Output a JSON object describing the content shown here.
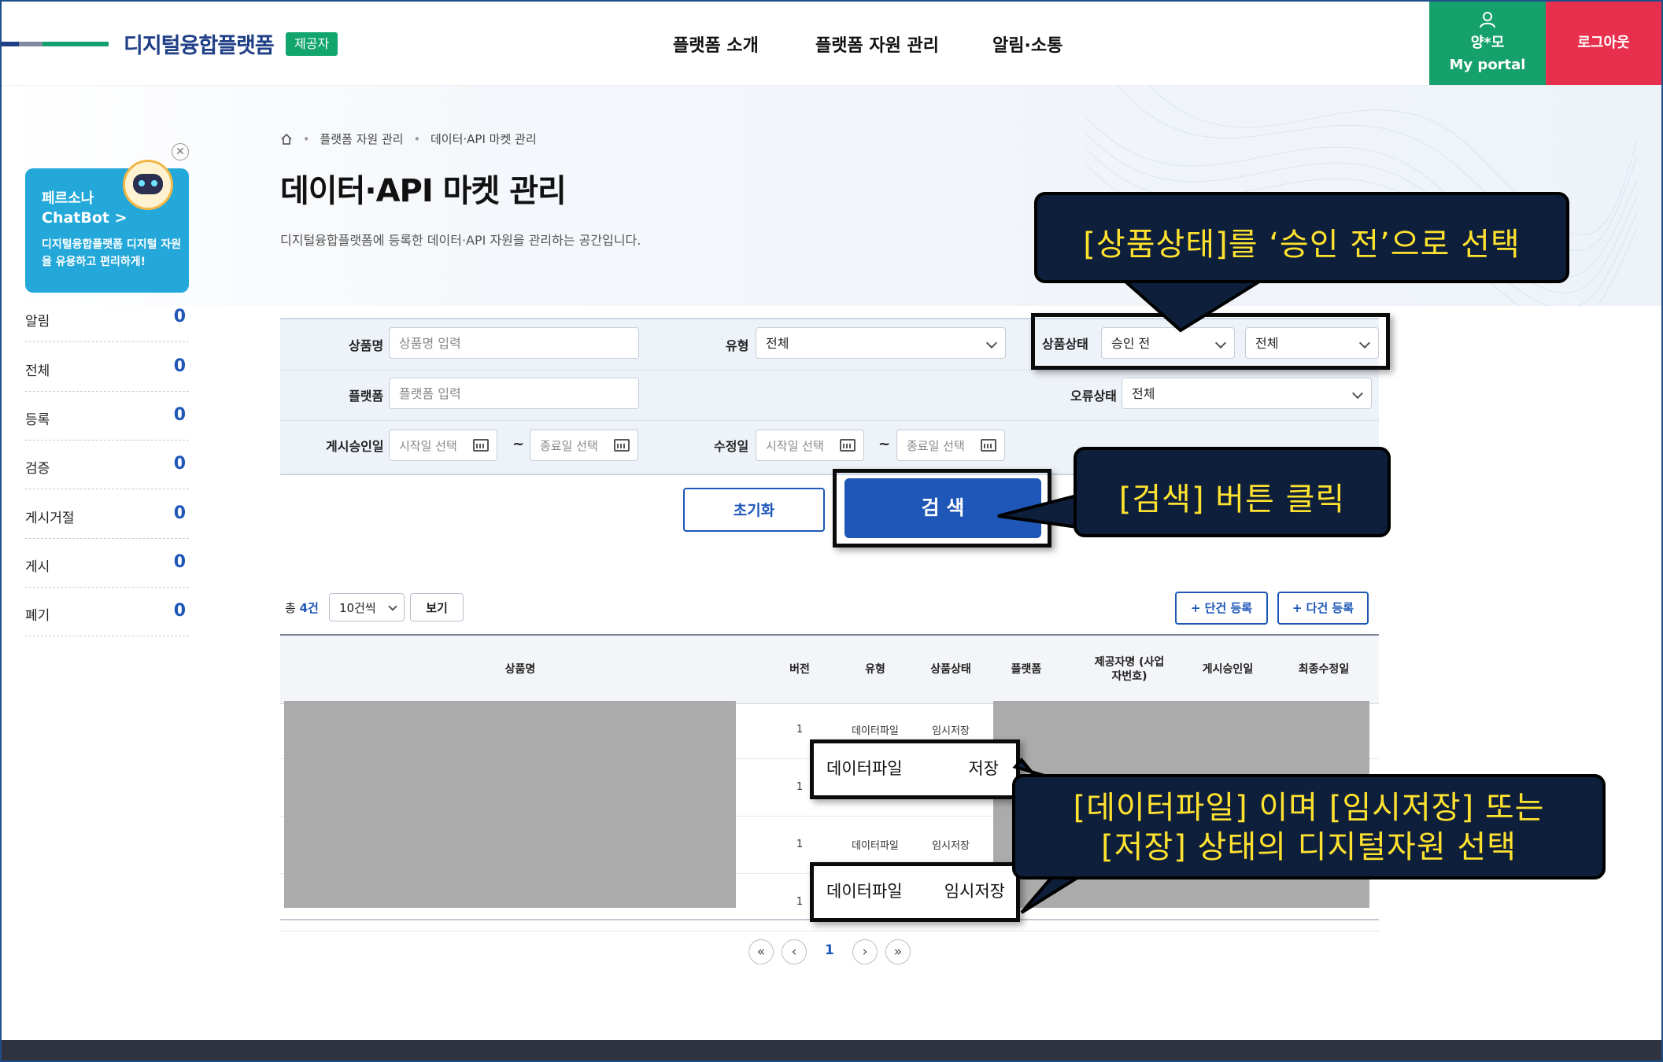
{
  "header": {
    "logo": "디지털융합플랫폼",
    "role_badge": "제공자",
    "nav": [
      "플랫폼 소개",
      "플랫폼 자원 관리",
      "알림·소통"
    ],
    "user_name": "양*모",
    "portal_label": "My portal",
    "logout": "로그아웃"
  },
  "chatbot": {
    "line1": "페르소나",
    "line2": "ChatBot >",
    "line3": "디지털융합플랫폼 디지털 자원을 유용하고 편리하게!"
  },
  "sidebar": {
    "items": [
      {
        "label": "알림",
        "count": "0"
      },
      {
        "label": "전체",
        "count": "0"
      },
      {
        "label": "등록",
        "count": "0"
      },
      {
        "label": "검증",
        "count": "0"
      },
      {
        "label": "게시거절",
        "count": "0"
      },
      {
        "label": "게시",
        "count": "0"
      },
      {
        "label": "폐기",
        "count": "0"
      }
    ]
  },
  "breadcrumb": [
    "플랫폼 자원 관리",
    "데이터·API 마켓 관리"
  ],
  "page": {
    "title": "데이터·API 마켓 관리",
    "description": "디지털융합플랫폼에 등록한 데이터·API 자원을 관리하는 공간입니다."
  },
  "search": {
    "product_name_label": "상품명",
    "product_name_placeholder": "상품명 입력",
    "type_label": "유형",
    "type_value": "전체",
    "status_label": "상품상태",
    "status_value": "승인 전",
    "status_sub_value": "전체",
    "platform_label": "플랫폼",
    "platform_placeholder": "플랫폼 입력",
    "error_label": "오류상태",
    "error_value": "전체",
    "post_date_label": "게시승인일",
    "mod_date_label": "수정일",
    "start_placeholder": "시작일 선택",
    "end_placeholder": "종료일 선택",
    "tilde": "~",
    "reset_button": "초기화",
    "search_button": "검 색"
  },
  "list": {
    "total_prefix": "총 ",
    "total_count": "4건",
    "page_size": "10건씩",
    "view_button": "보기",
    "single_register": "+ 단건 등록",
    "multi_register": "+ 다건 등록",
    "columns": [
      "상품명",
      "버전",
      "유형",
      "상품상태",
      "플랫폼",
      "제공자명 (사업자번호)",
      "게시승인일",
      "최종수정일"
    ],
    "rows": [
      {
        "version": "1",
        "type": "데이터파일",
        "status": "임시저장"
      },
      {
        "version": "1",
        "type": "데이터파일",
        "status": "저장"
      },
      {
        "version": "1",
        "type": "데이터파일",
        "status": "임시저장"
      },
      {
        "version": "1",
        "type": "데이터파일",
        "status": "임시저장"
      }
    ]
  },
  "pagination": {
    "current": "1"
  },
  "annotations": {
    "status_hint": "[상품상태]를 ‘승인 전’으로 선택",
    "search_hint": "[검색] 버튼 클릭",
    "select_hint_line1": "[데이터파일] 이며 [임시저장] 또는",
    "select_hint_line2": "[저장] 상태의 디지털자원 선택"
  }
}
